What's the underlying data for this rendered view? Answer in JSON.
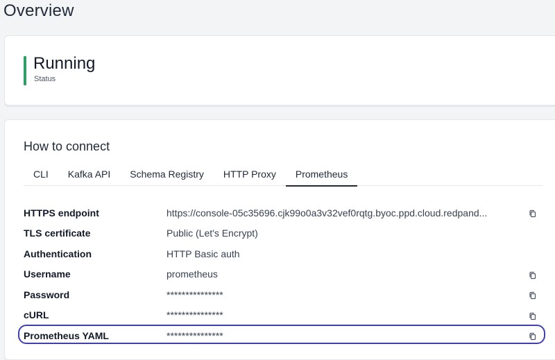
{
  "page": {
    "title": "Overview"
  },
  "status": {
    "value": "Running",
    "label": "Status",
    "color": "#2f9e66"
  },
  "connect": {
    "title": "How to connect",
    "tabs": [
      {
        "label": "CLI"
      },
      {
        "label": "Kafka API"
      },
      {
        "label": "Schema Registry"
      },
      {
        "label": "HTTP Proxy"
      },
      {
        "label": "Prometheus",
        "active": true
      }
    ],
    "rows": [
      {
        "label": "HTTPS endpoint",
        "value": "https://console-05c35696.cjk99o0a3v32vef0rqtg.byoc.ppd.cloud.redpand...",
        "copy": true
      },
      {
        "label": "TLS certificate",
        "value": "Public (Let's Encrypt)",
        "copy": false
      },
      {
        "label": "Authentication",
        "value": "HTTP Basic auth",
        "copy": false
      },
      {
        "label": "Username",
        "value": "prometheus",
        "copy": true
      },
      {
        "label": "Password",
        "value": "***************",
        "copy": true
      },
      {
        "label": "cURL",
        "value": "***************",
        "copy": true
      },
      {
        "label": "Prometheus YAML",
        "value": "***************",
        "copy": true,
        "highlighted": true
      }
    ]
  },
  "icons": {
    "copy": "copy-icon"
  },
  "colors": {
    "highlight": "#3f3fb0",
    "active_tab": "#1f2937"
  }
}
